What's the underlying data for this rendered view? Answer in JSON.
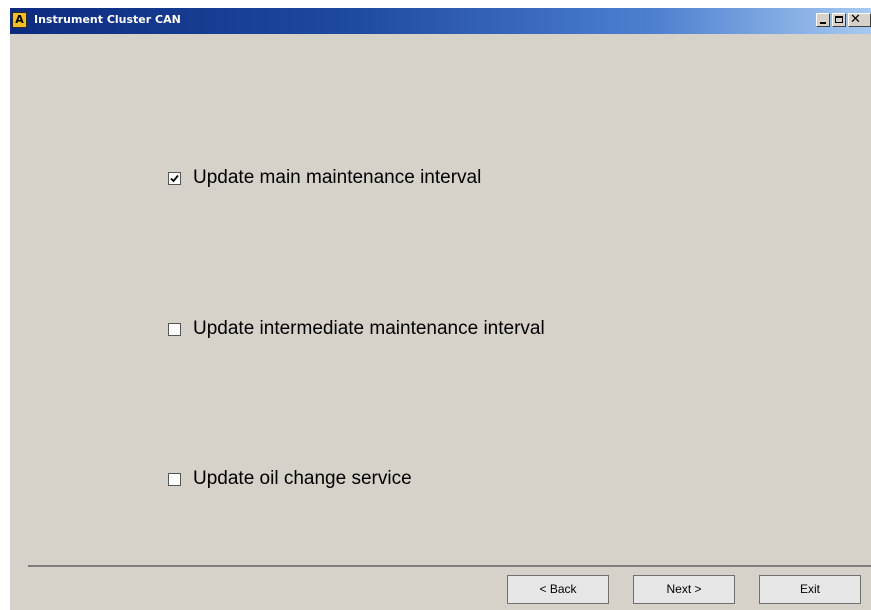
{
  "window": {
    "title": "Instrument Cluster CAN",
    "app_icon_letter": "A",
    "controls": {
      "minimize": "minimize",
      "maximize": "maximize",
      "close": "×"
    }
  },
  "options": [
    {
      "label": "Update main maintenance interval",
      "checked": true
    },
    {
      "label": "Update intermediate maintenance interval",
      "checked": false
    },
    {
      "label": "Update oil change service",
      "checked": false
    }
  ],
  "buttons": {
    "back": "< Back",
    "next": "Next >",
    "exit": "Exit"
  },
  "colors": {
    "window_bg": "#d6d2c9",
    "titlebar_start": "#0c2b7e",
    "titlebar_end": "#a6caf0"
  }
}
